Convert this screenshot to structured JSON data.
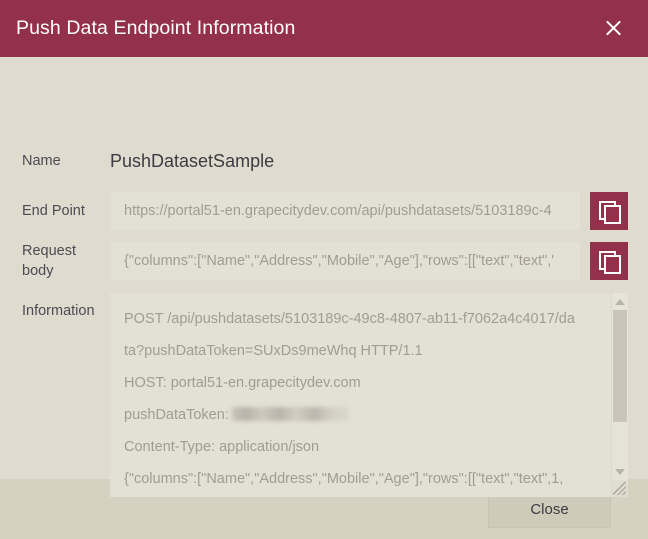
{
  "titlebar": {
    "title": "Push Data Endpoint Information",
    "close_icon": "close-icon"
  },
  "form": {
    "name": {
      "label": "Name",
      "value": "PushDatasetSample"
    },
    "end_point": {
      "label": "End Point",
      "value": "https://portal51-en.grapecitydev.com/api/pushdatasets/5103189c-4",
      "copy_icon": "copy-icon"
    },
    "request_body": {
      "label_line1": "Request",
      "label_line2": "body",
      "value": "{\"columns\":[\"Name\",\"Address\",\"Mobile\",\"Age\"],\"rows\":[[\"text\",\"text\",'",
      "copy_icon": "copy-icon"
    },
    "information": {
      "label": "Information",
      "lines": [
        "POST /api/pushdatasets/5103189c-49c8-4807-ab11-f7062a4c4017/da",
        "ta?pushDataToken=SUxDs9meWhq HTTP/1.1",
        "HOST: portal51-en.grapecitydev.com",
        "pushDataToken:",
        "Content-Type: application/json",
        "{\"columns\":[\"Name\",\"Address\",\"Mobile\",\"Age\"],\"rows\":[[\"text\",\"text\",1,"
      ],
      "redacted_token_label": "redacted",
      "scrollbar": {
        "up_icon": "chevron-up-icon",
        "down_icon": "chevron-down-icon",
        "resize_icon": "resize-grip-icon"
      }
    }
  },
  "footer": {
    "close_label": "Close"
  },
  "colors": {
    "accent": "#93304a",
    "dialog_background": "#dfdccf",
    "field_background": "#e3e1d4",
    "footer_background": "#d5d2c2",
    "label_text": "#4b4b52",
    "placeholder_text": "#a09c91"
  }
}
